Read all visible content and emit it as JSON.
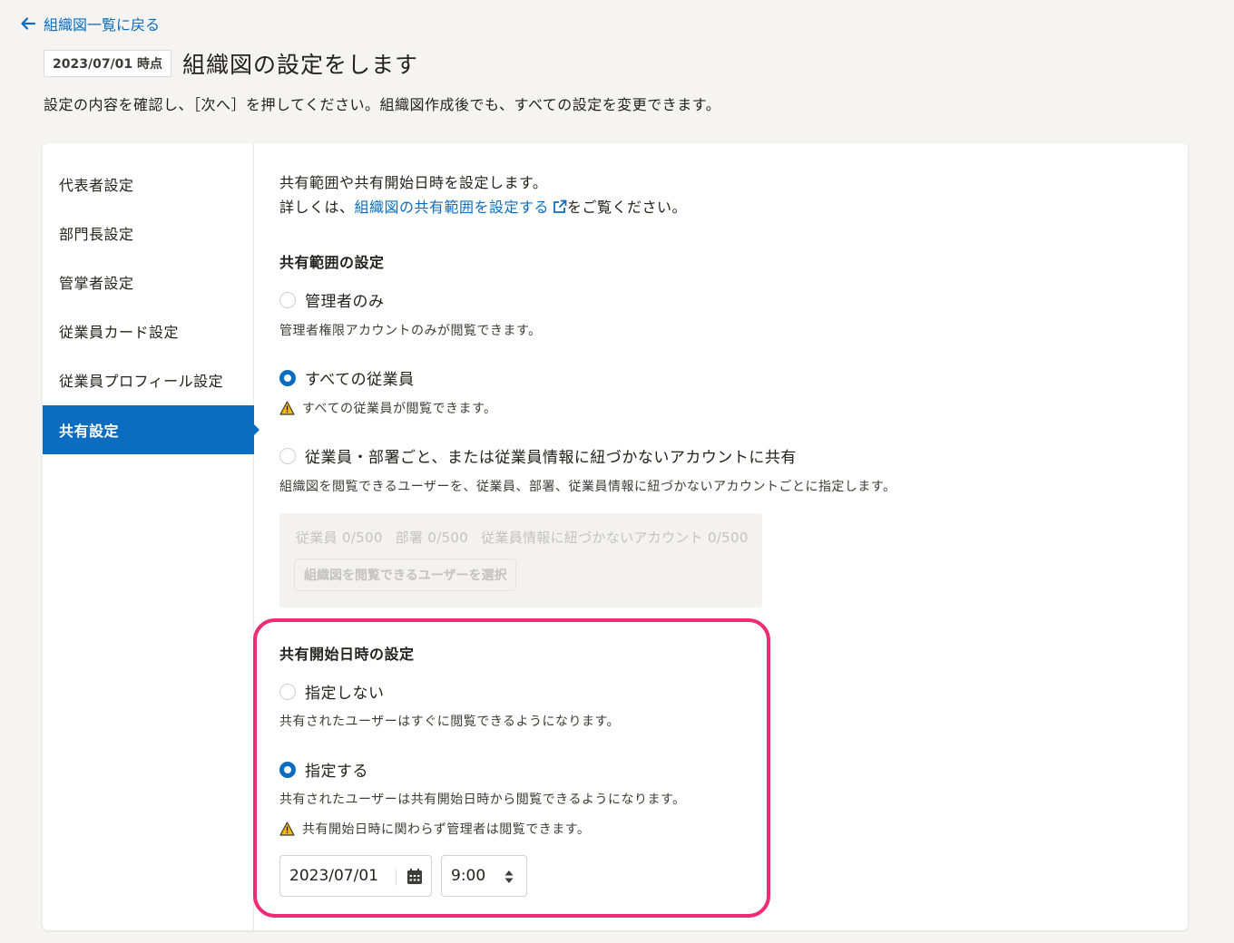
{
  "back_link": "組織図一覧に戻る",
  "header": {
    "date_badge": "2023/07/01 時点",
    "title": "組織図の設定をします",
    "description": "設定の内容を確認し、［次へ］を押してください。組織図作成後でも、すべての設定を変更できます。"
  },
  "sidebar": {
    "items": [
      {
        "label": "代表者設定"
      },
      {
        "label": "部門長設定"
      },
      {
        "label": "管掌者設定"
      },
      {
        "label": "従業員カード設定"
      },
      {
        "label": "従業員プロフィール設定"
      },
      {
        "label": "共有設定",
        "active": true
      }
    ]
  },
  "main": {
    "intro_line1": "共有範囲や共有開始日時を設定します。",
    "intro_prefix": "詳しくは、",
    "intro_link": "組織図の共有範囲を設定する",
    "intro_suffix": "をご覧ください。",
    "scope": {
      "heading": "共有範囲の設定",
      "options": [
        {
          "label": "管理者のみ",
          "help": "管理者権限アカウントのみが閲覧できます。",
          "selected": false
        },
        {
          "label": "すべての従業員",
          "warning": "すべての従業員が閲覧できます。",
          "selected": true
        },
        {
          "label": "従業員・部署ごと、または従業員情報に紐づかないアカウントに共有",
          "help": "組織図を閲覧できるユーザーを、従業員、部署、従業員情報に紐づかないアカウントごとに指定します。",
          "selected": false
        }
      ],
      "counts": {
        "employees": "従業員 0/500",
        "departments": "部署 0/500",
        "accounts": "従業員情報に紐づかないアカウント 0/500"
      },
      "select_button": "組織図を閲覧できるユーザーを選択"
    },
    "start": {
      "heading": "共有開始日時の設定",
      "options": [
        {
          "label": "指定しない",
          "help": "共有されたユーザーはすぐに閲覧できるようになります。",
          "selected": false
        },
        {
          "label": "指定する",
          "help": "共有されたユーザーは共有開始日時から閲覧できるようになります。",
          "warning": "共有開始日時に関わらず管理者は閲覧できます。",
          "selected": true
        }
      ],
      "date_value": "2023/07/01",
      "time_value": "9:00"
    }
  },
  "colors": {
    "accent": "#0b6cc0",
    "highlight": "#ee2d76",
    "warning": "#f5b800"
  },
  "icons": [
    "arrow-left-icon",
    "external-link-icon",
    "warning-icon",
    "calendar-icon",
    "sort-spinner-icon"
  ]
}
